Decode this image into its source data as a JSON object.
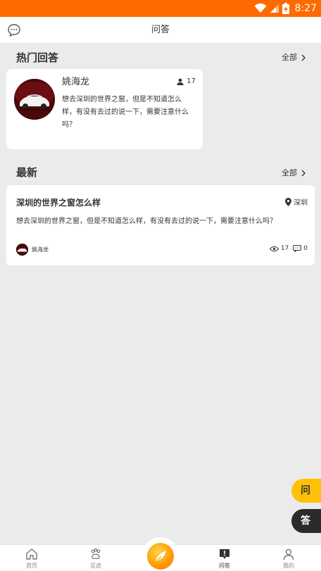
{
  "status_bar": {
    "time": "8:27",
    "wifi_icon": "wifi-icon",
    "signal_icon": "signal-icon",
    "battery_icon": "battery-charging-icon"
  },
  "header": {
    "title": "问答",
    "left_icon": "chat-bubble-icon"
  },
  "hot": {
    "section_title": "热门回答",
    "more_label": "全部",
    "card": {
      "author": "姚海龙",
      "count": "17",
      "body": "想去深圳的世界之窗，但是不知道怎么样，有没有去过的说一下，需要注意什么吗？"
    }
  },
  "latest": {
    "section_title": "最新",
    "more_label": "全部",
    "card": {
      "title": "深圳的世界之窗怎么样",
      "location": "深圳",
      "body": "想去深圳的世界之窗，但是不知道怎么样，有没有去过的说一下，需要注意什么吗？",
      "author": "姚海龙",
      "views": "17",
      "comments": "0"
    }
  },
  "floating": {
    "ask_label": "问",
    "answer_label": "答"
  },
  "tabs": [
    {
      "label": "首页",
      "icon": "home-icon"
    },
    {
      "label": "足迹",
      "icon": "paw-icon"
    },
    {
      "label": "",
      "icon": "feather-icon"
    },
    {
      "label": "问答",
      "icon": "qa-icon"
    },
    {
      "label": "我的",
      "icon": "user-icon"
    }
  ],
  "colors": {
    "status_bar": "#ff6a00",
    "ask_button": "#ffc107",
    "answer_button": "#2b2b2b",
    "center_button": "#ff9800"
  }
}
